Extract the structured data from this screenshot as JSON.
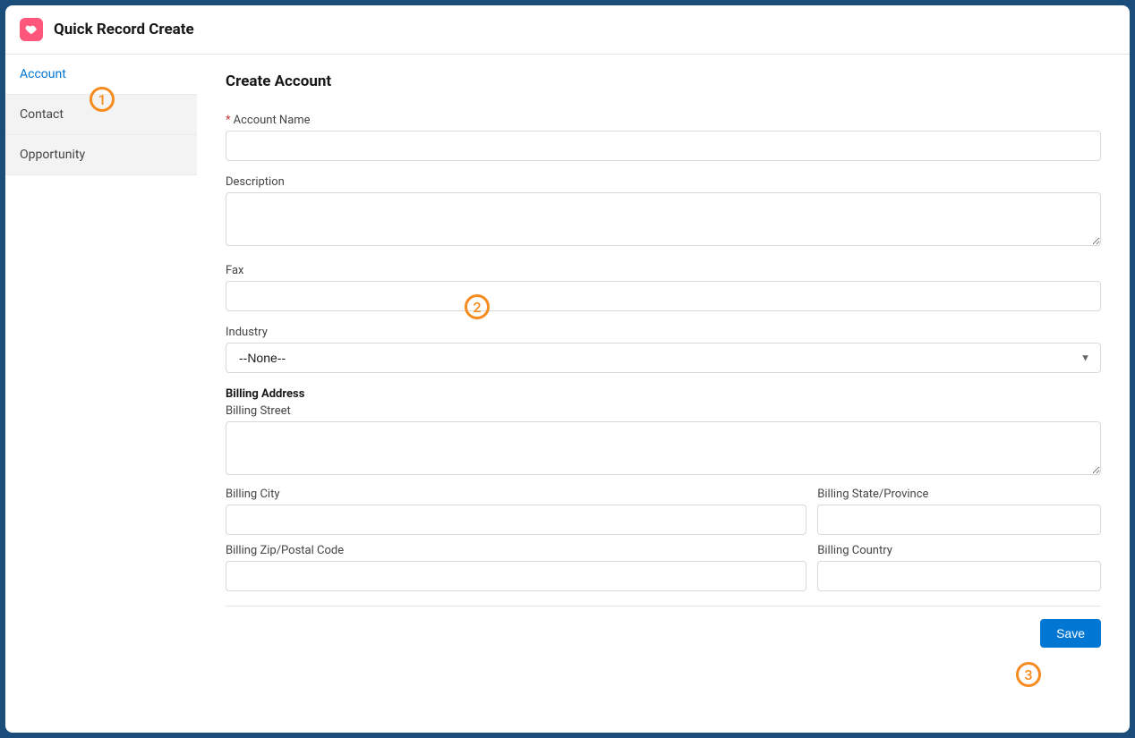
{
  "header": {
    "title": "Quick Record Create"
  },
  "sidebar": {
    "items": [
      {
        "label": "Account",
        "active": true
      },
      {
        "label": "Contact",
        "active": false
      },
      {
        "label": "Opportunity",
        "active": false
      }
    ]
  },
  "main": {
    "title": "Create Account",
    "fields": {
      "account_name": {
        "label": "Account Name",
        "required": true,
        "value": ""
      },
      "description": {
        "label": "Description",
        "value": ""
      },
      "fax": {
        "label": "Fax",
        "value": ""
      },
      "industry": {
        "label": "Industry",
        "selected": "--None--"
      },
      "billing_section": {
        "label": "Billing Address"
      },
      "billing_street": {
        "label": "Billing Street",
        "value": ""
      },
      "billing_city": {
        "label": "Billing City",
        "value": ""
      },
      "billing_state": {
        "label": "Billing State/Province",
        "value": ""
      },
      "billing_zip": {
        "label": "Billing Zip/Postal Code",
        "value": ""
      },
      "billing_country": {
        "label": "Billing Country",
        "value": ""
      }
    },
    "save_label": "Save"
  },
  "annotations": {
    "one": "1",
    "two": "2",
    "three": "3"
  }
}
